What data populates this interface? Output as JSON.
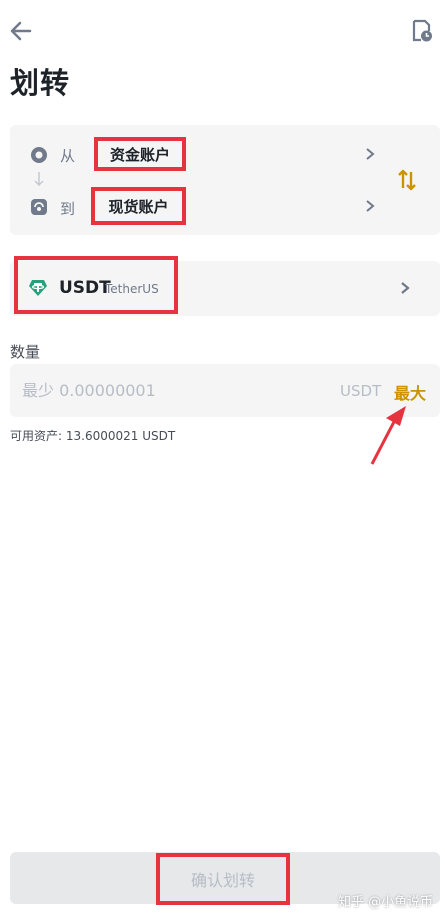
{
  "header": {
    "title": "划转",
    "back_icon": "arrow-left-icon",
    "history_icon": "history-icon"
  },
  "transfer": {
    "from_prefix": "从",
    "from_account": "资金账户",
    "to_prefix": "到",
    "to_account": "现货账户",
    "swap_icon": "swap-vertical-icon"
  },
  "coin": {
    "symbol": "USDT",
    "name": "TetherUS",
    "icon": "tether-icon"
  },
  "amount": {
    "label": "数量",
    "placeholder": "最少 0.00000001",
    "unit": "USDT",
    "max_label": "最大",
    "available_text": "可用资产: 13.6000021 USDT"
  },
  "confirm": {
    "label": "确认划转"
  },
  "watermark": "知乎 @小鱼说币",
  "colors": {
    "accent": "#c99400",
    "highlight": "#e5343f",
    "tether": "#26a17b"
  }
}
